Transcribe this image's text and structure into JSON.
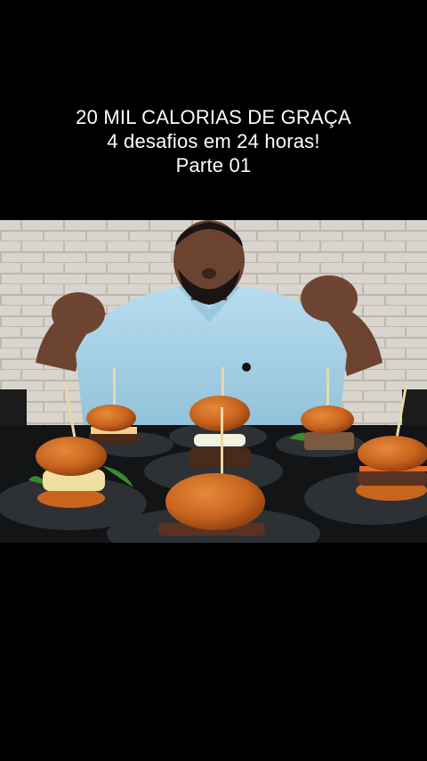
{
  "caption": {
    "line1": "20 MIL CALORIAS DE GRAÇA",
    "line2": "4 desafios em 24 horas!",
    "line3": "Parte 01"
  },
  "photo": {
    "subject": "man-with-raised-fists-behind-burgers",
    "colors": {
      "background": "#000000",
      "brick": "#d9d4cd",
      "mortar": "#bdb7ae",
      "shirt": "#a9d3e8",
      "skin": "#6b4330",
      "bun": "#c9641e",
      "plate": "#2d3134",
      "table": "#121416"
    }
  }
}
